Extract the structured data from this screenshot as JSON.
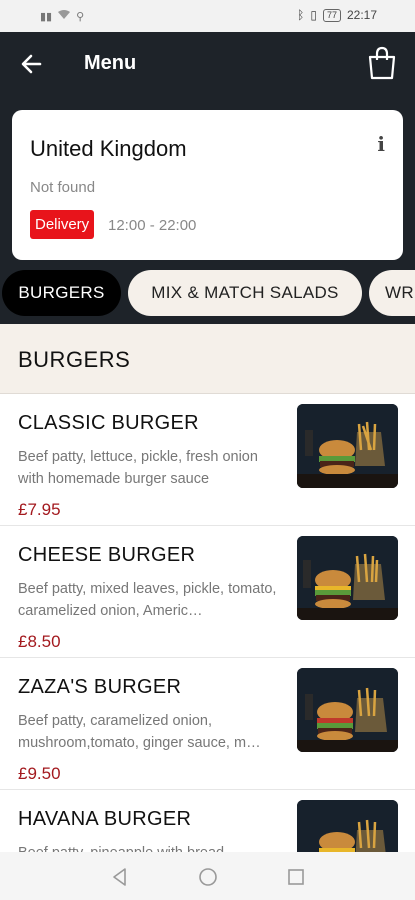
{
  "status_bar": {
    "time": "22:17",
    "battery": "77"
  },
  "header": {
    "title": "Menu"
  },
  "store": {
    "name": "United Kingdom",
    "status": "Not found",
    "badge": "Delivery",
    "hours": "12:00 - 22:00"
  },
  "tabs": [
    {
      "label": "BURGERS"
    },
    {
      "label": "MIX & MATCH SALADS"
    },
    {
      "label": "WR"
    }
  ],
  "section": {
    "title": "BURGERS"
  },
  "items": [
    {
      "name": "CLASSIC BURGER",
      "description": "Beef patty, lettuce, pickle, fresh onion with homemade burger sauce",
      "price": "£7.95"
    },
    {
      "name": "CHEESE BURGER",
      "description": "Beef patty, mixed leaves, pickle, tomato, caramelized onion, Americ…",
      "price": "£8.50"
    },
    {
      "name": "ZAZA'S BURGER",
      "description": "Beef patty, caramelized onion, mushroom,tomato, ginger sauce, m…",
      "price": "£9.50"
    },
    {
      "name": "HAVANA BURGER",
      "description": "Beef patty, pineapple with bread",
      "price": ""
    }
  ],
  "colors": {
    "header_bg": "#1e2329",
    "badge_red": "#e8141b",
    "price_red": "#a3191e",
    "tab_inactive_bg": "#f5f0ea"
  }
}
